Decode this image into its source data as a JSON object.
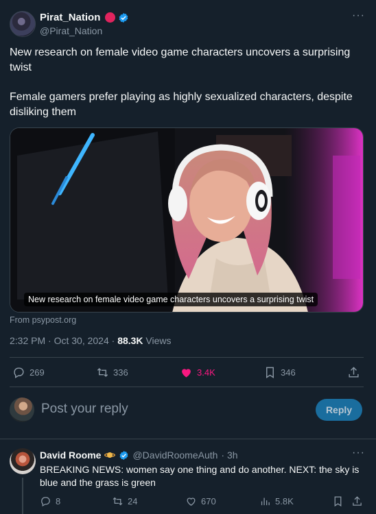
{
  "post": {
    "author_name": "Pirat_Nation",
    "author_handle": "@Pirat_Nation",
    "more": "···",
    "text_line1": "New research on female video game characters uncovers a surprising twist",
    "text_line2": "Female gamers prefer playing as highly sexualized characters, despite disliking them",
    "media_caption": "New research on female video game characters uncovers a surprising twist",
    "source": "From psypost.org",
    "time": "2:32 PM · Oct 30, 2024 · ",
    "views_count": "88.3K",
    "views_label": " Views"
  },
  "actions": {
    "replies": "269",
    "reposts": "336",
    "likes": "3.4K",
    "bookmarks": "346"
  },
  "composer": {
    "placeholder": "Post your reply",
    "button_label": "Reply"
  },
  "reply": {
    "name": "David Roome",
    "handle": "@DavidRoomeAuth",
    "time": "· 3h",
    "more": "···",
    "text": "BREAKING NEWS: women say one thing and do another. NEXT: the sky is blue and the grass is green",
    "replies": "8",
    "reposts": "24",
    "likes": "670",
    "views": "5.8K"
  },
  "colors": {
    "background": "#15202b",
    "like_active": "#f91880",
    "verified": "#1d9bf0",
    "reply_button": "#1a6d9e"
  }
}
